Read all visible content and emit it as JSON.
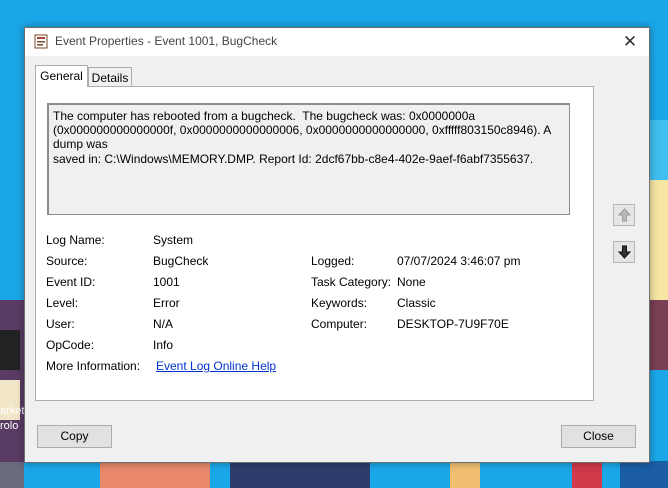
{
  "window": {
    "title": "Event Properties - Event 1001, BugCheck",
    "close_glyph": "✕"
  },
  "tabs": [
    {
      "label": "General"
    },
    {
      "label": "Details"
    }
  ],
  "description": "The computer has rebooted from a bugcheck.  The bugcheck was: 0x0000000a\n(0x000000000000000f, 0x0000000000000006, 0x0000000000000000, 0xfffff803150c8946). A dump was\nsaved in: C:\\Windows\\MEMORY.DMP. Report Id: 2dcf67bb-c8e4-402e-9aef-f6abf7355637.",
  "fields": {
    "log_name": {
      "label": "Log Name:",
      "value": "System"
    },
    "source": {
      "label": "Source:",
      "value": "BugCheck"
    },
    "event_id": {
      "label": "Event ID:",
      "value": "1001"
    },
    "level": {
      "label": "Level:",
      "value": "Error"
    },
    "user": {
      "label": "User:",
      "value": "N/A"
    },
    "opcode": {
      "label": "OpCode:",
      "value": "Info"
    },
    "more_info": {
      "label": "More Information:",
      "value": "Event Log Online Help"
    },
    "logged": {
      "label": "Logged:",
      "value": "07/07/2024 3:46:07 pm"
    },
    "task_category": {
      "label": "Task Category:",
      "value": "None"
    },
    "keywords": {
      "label": "Keywords:",
      "value": "Classic"
    },
    "computer": {
      "label": "Computer:",
      "value": "DESKTOP-7U9F70E"
    }
  },
  "buttons": {
    "copy": "Copy",
    "close": "Close"
  },
  "background_text": [
    "arket",
    "rolo"
  ]
}
